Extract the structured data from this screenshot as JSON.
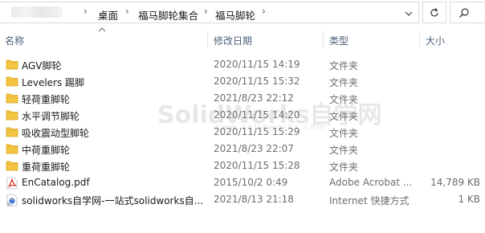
{
  "address_bar": {
    "crumbs": [
      "桌面",
      "福马脚轮集合",
      "福马脚轮"
    ],
    "separator": "›"
  },
  "columns": {
    "name": "名称",
    "date": "修改日期",
    "type": "类型",
    "size": "大小"
  },
  "files": [
    {
      "name": "AGV脚轮",
      "date": "2020/11/15 14:19",
      "type": "文件夹",
      "size": "",
      "icon": "folder-icon"
    },
    {
      "name": "Levelers 踢脚",
      "date": "2020/11/15 15:32",
      "type": "文件夹",
      "size": "",
      "icon": "folder-icon"
    },
    {
      "name": "轻荷重脚轮",
      "date": "2021/8/23 22:12",
      "type": "文件夹",
      "size": "",
      "icon": "folder-icon"
    },
    {
      "name": "水平调节脚轮",
      "date": "2020/11/15 14:20",
      "type": "文件夹",
      "size": "",
      "icon": "folder-icon"
    },
    {
      "name": "吸收震动型脚轮",
      "date": "2020/11/15 15:29",
      "type": "文件夹",
      "size": "",
      "icon": "folder-icon"
    },
    {
      "name": "中荷重脚轮",
      "date": "2021/8/23 22:07",
      "type": "文件夹",
      "size": "",
      "icon": "folder-icon"
    },
    {
      "name": "重荷重脚轮",
      "date": "2020/11/15 15:28",
      "type": "文件夹",
      "size": "",
      "icon": "folder-icon"
    },
    {
      "name": "EnCatalog.pdf",
      "date": "2015/10/2 0:49",
      "type": "Adobe Acrobat ...",
      "size": "14,789 KB",
      "icon": "pdf-icon"
    },
    {
      "name": "solidworks自学网-一站式solidworks自...",
      "date": "2021/8/13 21:18",
      "type": "Internet 快捷方式",
      "size": "1 KB",
      "icon": "internet-shortcut-icon"
    }
  ],
  "watermark": {
    "text": "SolidWorks自学网",
    "url": "www.solidworks.com"
  },
  "colors": {
    "folder": "#f4c542",
    "header_text": "#4c607a",
    "border": "#d9d9d9",
    "pdf": "#d9261c"
  }
}
